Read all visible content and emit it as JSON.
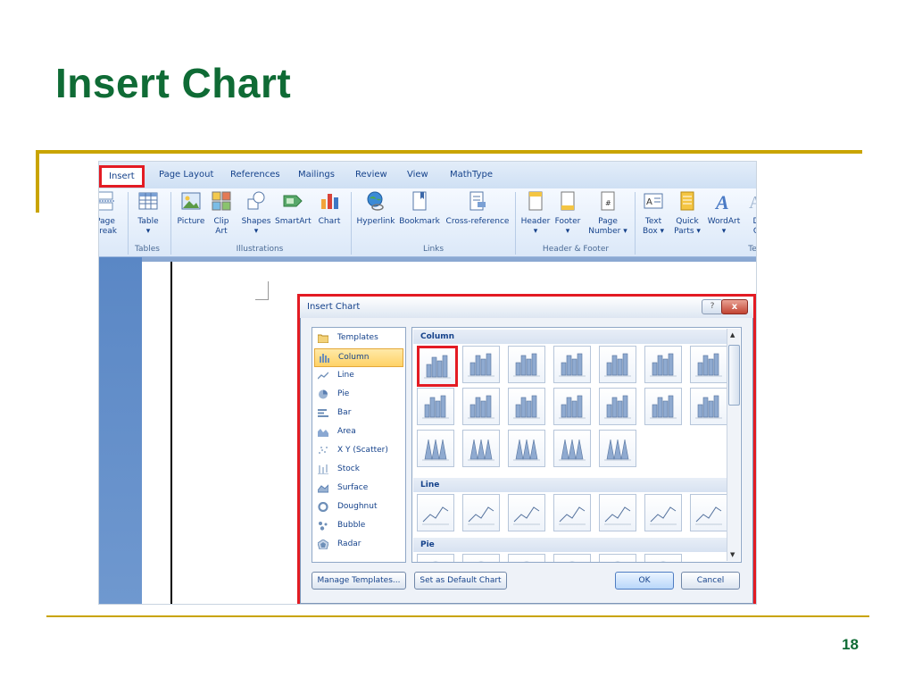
{
  "slide": {
    "title": "Insert Chart",
    "page_number": "18"
  },
  "ribbon": {
    "tabs": [
      "Insert",
      "Page Layout",
      "References",
      "Mailings",
      "Review",
      "View",
      "MathType"
    ],
    "active_tab": "Insert",
    "buttons": [
      {
        "label": "Page\nBreak",
        "icon": "page-break-icon"
      },
      {
        "label": "Table\n▾",
        "icon": "table-icon"
      },
      {
        "label": "Picture",
        "icon": "picture-icon"
      },
      {
        "label": "Clip\nArt",
        "icon": "clip-art-icon"
      },
      {
        "label": "Shapes\n▾",
        "icon": "shapes-icon"
      },
      {
        "label": "SmartArt",
        "icon": "smartart-icon"
      },
      {
        "label": "Chart",
        "icon": "chart-icon"
      },
      {
        "label": "Hyperlink",
        "icon": "hyperlink-icon"
      },
      {
        "label": "Bookmark",
        "icon": "bookmark-icon"
      },
      {
        "label": "Cross-reference",
        "icon": "cross-reference-icon"
      },
      {
        "label": "Header\n▾",
        "icon": "header-icon"
      },
      {
        "label": "Footer\n▾",
        "icon": "footer-icon"
      },
      {
        "label": "Page\nNumber ▾",
        "icon": "page-number-icon"
      },
      {
        "label": "Text\nBox ▾",
        "icon": "text-box-icon"
      },
      {
        "label": "Quick\nParts ▾",
        "icon": "quick-parts-icon"
      },
      {
        "label": "WordArt\n▾",
        "icon": "wordart-icon"
      },
      {
        "label": "D\nC",
        "icon": "drop-cap-icon"
      }
    ],
    "groups": [
      "Tables",
      "Illustrations",
      "Links",
      "Header & Footer",
      "Te"
    ]
  },
  "dialog": {
    "title": "Insert Chart",
    "help_label": "?",
    "close_label": "x",
    "chart_types": [
      {
        "label": "Templates",
        "icon": "folder-icon"
      },
      {
        "label": "Column",
        "icon": "column-chart-icon"
      },
      {
        "label": "Line",
        "icon": "line-chart-icon"
      },
      {
        "label": "Pie",
        "icon": "pie-chart-icon"
      },
      {
        "label": "Bar",
        "icon": "bar-chart-icon"
      },
      {
        "label": "Area",
        "icon": "area-chart-icon"
      },
      {
        "label": "X Y (Scatter)",
        "icon": "scatter-chart-icon"
      },
      {
        "label": "Stock",
        "icon": "stock-chart-icon"
      },
      {
        "label": "Surface",
        "icon": "surface-chart-icon"
      },
      {
        "label": "Doughnut",
        "icon": "doughnut-chart-icon"
      },
      {
        "label": "Bubble",
        "icon": "bubble-chart-icon"
      },
      {
        "label": "Radar",
        "icon": "radar-chart-icon"
      }
    ],
    "selected_type": "Column",
    "sections": {
      "column": "Column",
      "line": "Line",
      "pie": "Pie"
    },
    "buttons": {
      "manage_templates": "Manage Templates...",
      "set_default": "Set as Default Chart",
      "ok": "OK",
      "cancel": "Cancel"
    }
  },
  "colors": {
    "title_green": "#0f6b35",
    "gold_rule": "#c9a400",
    "highlight_red": "#e31b23",
    "ribbon_text": "#15428b"
  }
}
